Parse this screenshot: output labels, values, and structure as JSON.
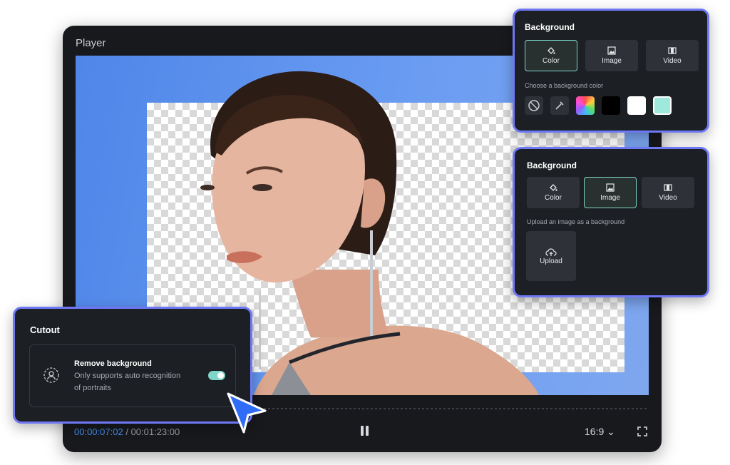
{
  "player": {
    "title": "Player",
    "current_time": "00:00:07:02",
    "time_separator": "/",
    "total_time": "00:01:23:00",
    "aspect_ratio": "16:9",
    "aspect_ratio_chevron": "⌄"
  },
  "bg_color_panel": {
    "title": "Background",
    "tabs": [
      {
        "label": "Color",
        "icon": "paint-bucket-icon",
        "active": true
      },
      {
        "label": "Image",
        "icon": "image-icon",
        "active": false
      },
      {
        "label": "Video",
        "icon": "film-icon",
        "active": false
      }
    ],
    "hint": "Choose a background color",
    "swatches": [
      "none",
      "eyedropper",
      "gradient",
      "#000000",
      "#ffffff",
      "#9ee8dc"
    ]
  },
  "bg_image_panel": {
    "title": "Background",
    "tabs": [
      {
        "label": "Color",
        "icon": "paint-bucket-icon",
        "active": false
      },
      {
        "label": "Image",
        "icon": "image-icon",
        "active": true
      },
      {
        "label": "Video",
        "icon": "film-icon",
        "active": false
      }
    ],
    "hint": "Upload an image as a background",
    "upload_label": "Upload"
  },
  "cutout_panel": {
    "title": "Cutout",
    "option_title": "Remove background",
    "option_desc_line1": "Only supports auto recognition",
    "option_desc_line2": "of portraits",
    "toggle_on": true
  },
  "colors": {
    "accent_border": "#6e78f5",
    "active_tab_border": "#7fd6c8",
    "time_current": "#4b8ff0",
    "cursor": "#2f6df6"
  }
}
